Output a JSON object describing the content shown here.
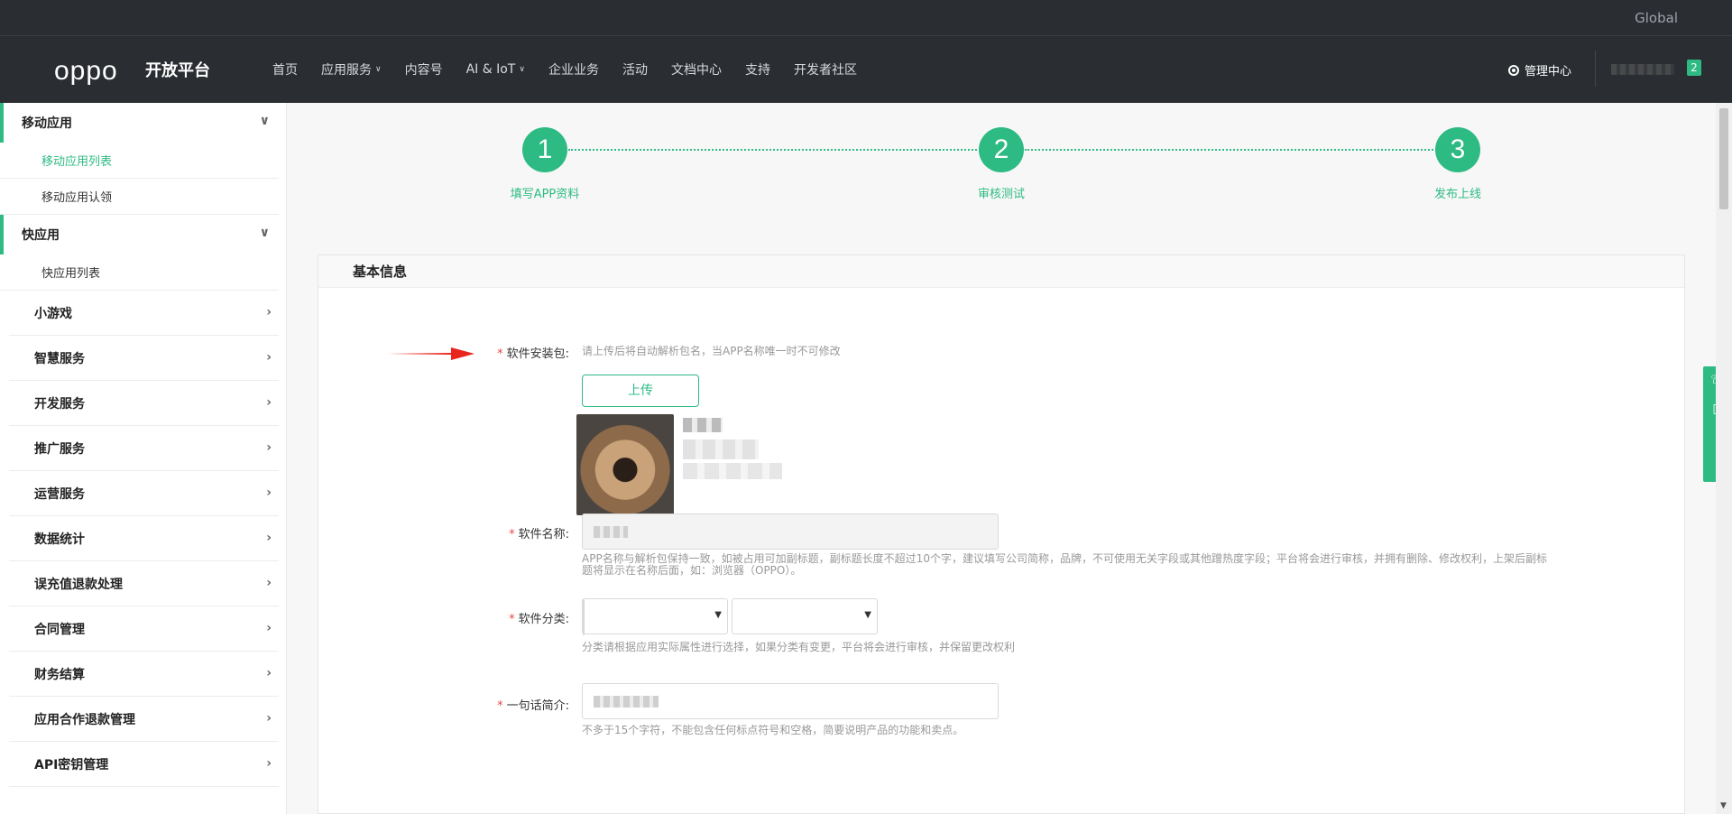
{
  "topbar": {
    "global": "Global"
  },
  "navbar": {
    "logo": "oppo",
    "platform": "开放平台",
    "items": [
      {
        "label": "首页",
        "dropdown": false
      },
      {
        "label": "应用服务",
        "dropdown": true
      },
      {
        "label": "内容号",
        "dropdown": false
      },
      {
        "label": "AI & IoT",
        "dropdown": true
      },
      {
        "label": "企业业务",
        "dropdown": false
      },
      {
        "label": "活动",
        "dropdown": false
      },
      {
        "label": "文档中心",
        "dropdown": false
      },
      {
        "label": "支持",
        "dropdown": false
      },
      {
        "label": "开发者社区",
        "dropdown": false
      }
    ],
    "management": "管理中心",
    "badge_count": "2",
    "user_name": "———…"
  },
  "sidebar": {
    "mobile_app": "移动应用",
    "mobile_app_list": "移动应用列表",
    "mobile_app_claim": "移动应用认领",
    "quick_app": "快应用",
    "quick_app_list": "快应用列表",
    "items": [
      "小游戏",
      "智慧服务",
      "开发服务",
      "推广服务",
      "运营服务",
      "数据统计",
      "误充值退款处理",
      "合同管理",
      "财务结算",
      "应用合作退款管理",
      "API密钥管理"
    ]
  },
  "steps": [
    {
      "num": "1",
      "label": "填写APP资料"
    },
    {
      "num": "2",
      "label": "审核测试"
    },
    {
      "num": "3",
      "label": "发布上线"
    }
  ],
  "form": {
    "section_title": "基本信息",
    "required_mark": "*",
    "package_label": "软件安装包:",
    "package_hint": "请上传后将自动解析包名，当APP名称唯一时不可修改",
    "upload_button": "上传",
    "name_label": "软件名称:",
    "name_hint_1": "APP名称与解析包保持一致，如被占用可加副标题，副标题长度不超过10个字，建议填写公司简称，品牌，不可使用无关字段或其他蹭热度字段；平台将会进行审核，并拥有删除、修改权利，上架后副标",
    "name_hint_2": "题将显示在名称后面，如：浏览器（OPPO）。",
    "category_label": "软件分类:",
    "category_hint": "分类请根据应用实际属性进行选择，如果分类有变更，平台将会进行审核，并保留更改权利",
    "intro_label": "一句话简介:",
    "intro_hint": "不多于15个字符，不能包含任何标点符号和空格，简要说明产品的功能和卖点。"
  },
  "colors": {
    "accent": "#2dbb83",
    "nav_bg": "#2a2d31",
    "required": "#e44444"
  }
}
